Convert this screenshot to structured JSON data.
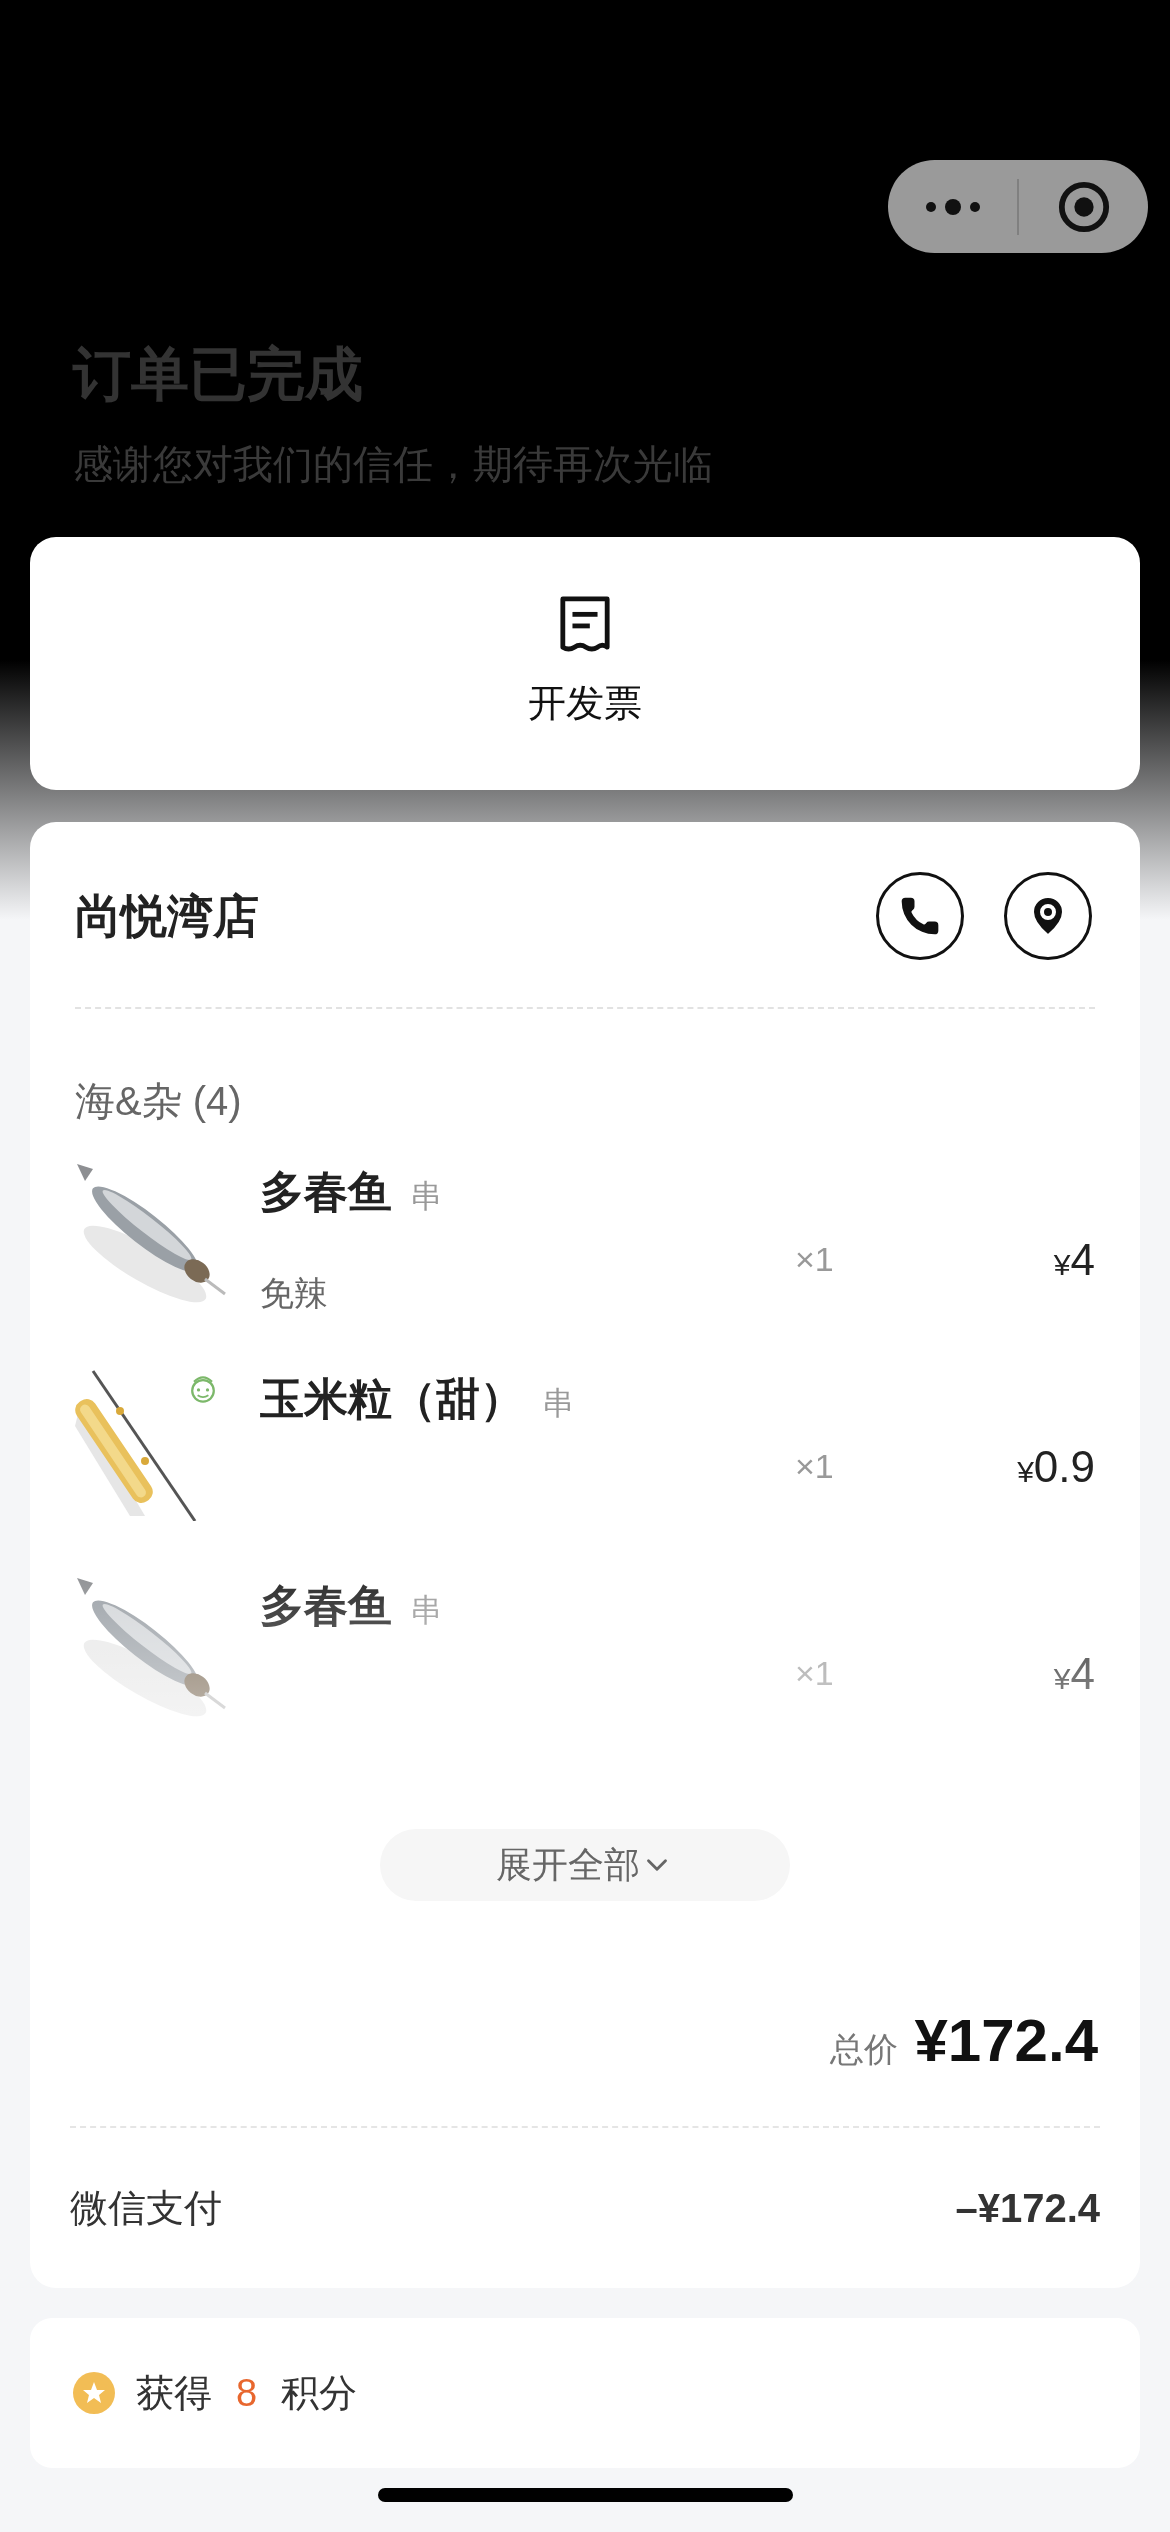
{
  "header": {
    "title": "订单已完成",
    "subtitle": "感谢您对我们的信任，期待再次光临"
  },
  "invoice": {
    "label": "开发票"
  },
  "store": {
    "name": "尚悦湾店",
    "category": {
      "label": "海&杂 (4)"
    },
    "items": [
      {
        "name": "多春鱼",
        "unit": "串",
        "note": "免辣",
        "kid_badge": false,
        "qty": "×1",
        "currency": "¥",
        "price": "4"
      },
      {
        "name": "玉米粒（甜）",
        "unit": "串",
        "kid_badge": true,
        "qty": "×1",
        "currency": "¥",
        "price": "0.9"
      },
      {
        "name": "多春鱼",
        "unit": "串",
        "kid_badge": false,
        "qty": "×1",
        "currency": "¥",
        "price": "4"
      }
    ],
    "expand_button": "展开全部",
    "total": {
      "label": "总价",
      "amount": "¥172.4"
    },
    "payment": {
      "method": "微信支付",
      "amount": "–¥172.4"
    }
  },
  "points": {
    "prefix": "获得",
    "value": "8",
    "suffix": "积分"
  }
}
